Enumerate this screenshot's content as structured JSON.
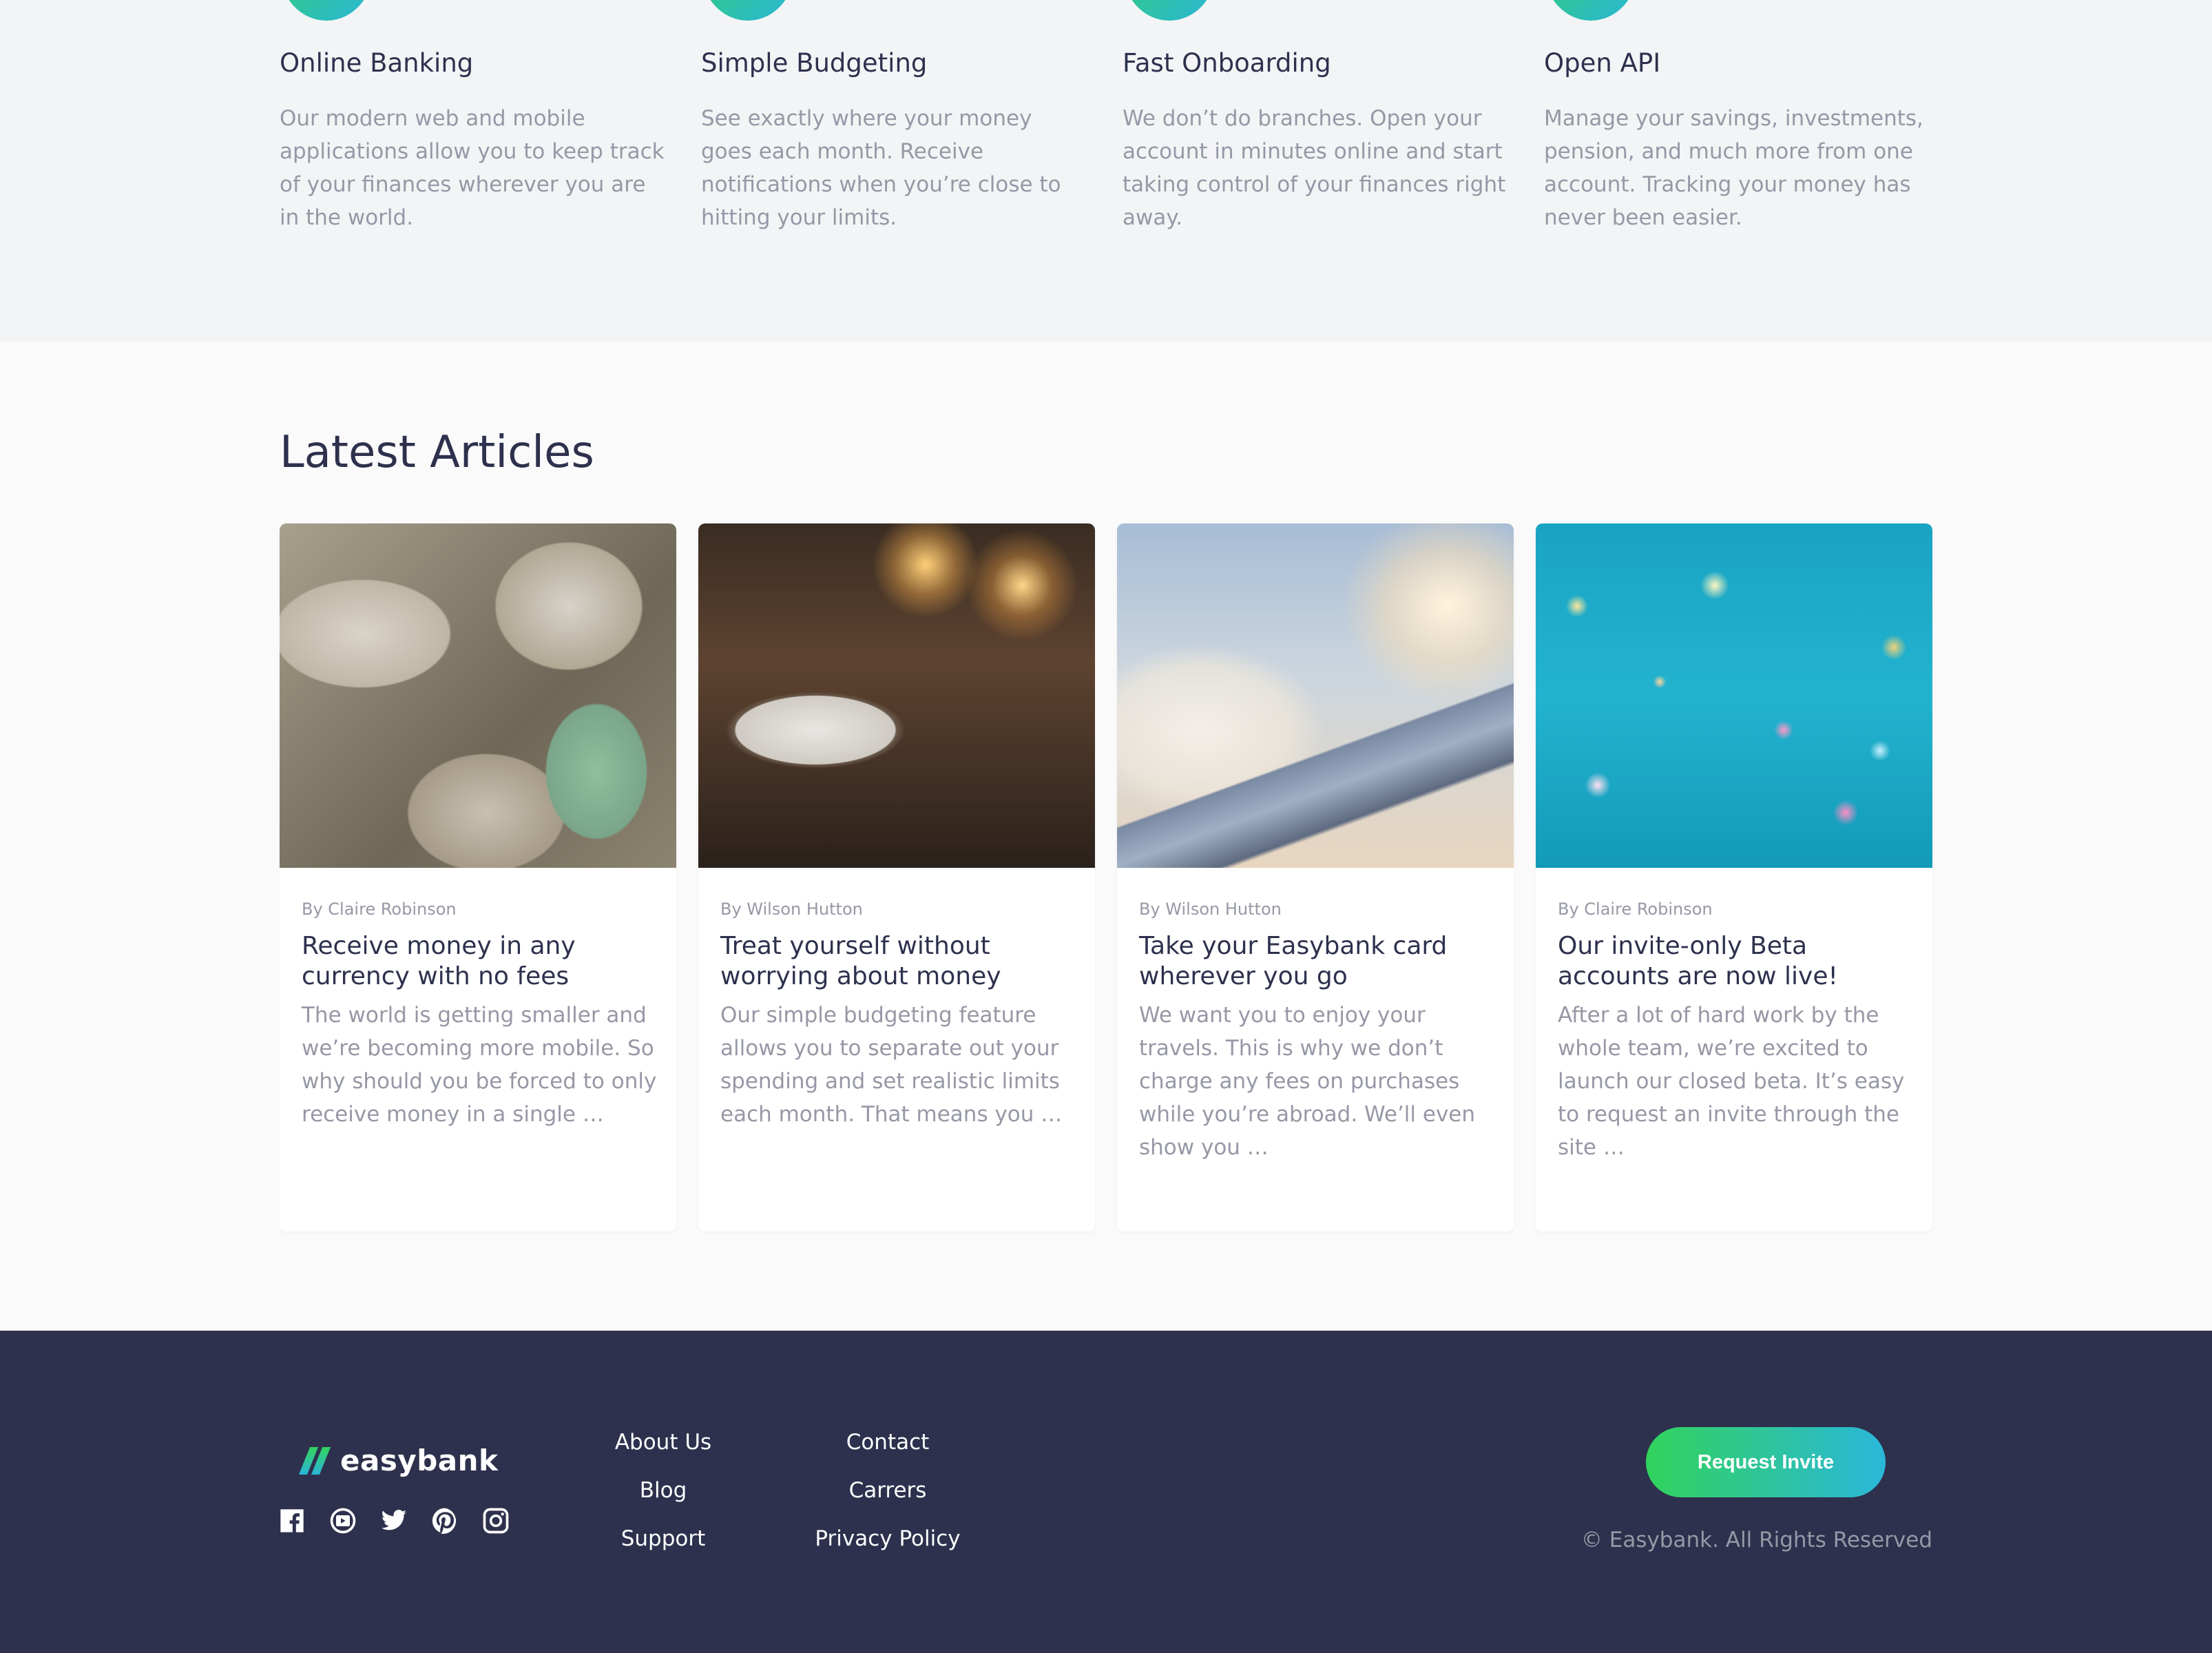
{
  "features": [
    {
      "title": "Online Banking",
      "body": "Our modern web and mobile applications allow you to keep track of your finances wherever you are in the world."
    },
    {
      "title": "Simple Budgeting",
      "body": "See exactly where your money goes each month. Receive notifications when you’re close to hitting your limits."
    },
    {
      "title": "Fast Onboarding",
      "body": "We don’t do branches. Open your account in minutes online and start taking control of your finances right away."
    },
    {
      "title": "Open API",
      "body": "Manage your savings, investments, pension, and much more from one account. Tracking your money has never been easier."
    }
  ],
  "articles": {
    "heading": "Latest Articles",
    "items": [
      {
        "author": "By Claire Robinson",
        "title": "Receive money in any currency with no fees",
        "excerpt": "The world is getting smaller and we’re becoming more mobile. So why should you be forced to only receive money in a single …"
      },
      {
        "author": "By Wilson Hutton",
        "title": "Treat yourself without worrying about money",
        "excerpt": "Our simple budgeting feature allows you to separate out your spending and set realistic limits each month. That means you …"
      },
      {
        "author": "By Wilson Hutton",
        "title": "Take your Easybank card wherever you go",
        "excerpt": "We want you to enjoy your travels. This is why we don’t charge any fees on purchases while you’re abroad. We’ll even show you …"
      },
      {
        "author": "By Claire Robinson",
        "title": "Our invite-only Beta accounts are now live!",
        "excerpt": "After a lot of hard work by the whole team, we’re excited to launch our closed beta. It’s easy to request an invite through the site …"
      }
    ]
  },
  "footer": {
    "brand": "easybank",
    "socials": [
      "facebook-icon",
      "youtube-icon",
      "twitter-icon",
      "pinterest-icon",
      "instagram-icon"
    ],
    "links_col1": [
      "About Us",
      "Blog",
      "Support"
    ],
    "links_col2": [
      "Contact",
      "Carrers",
      "Privacy Policy"
    ],
    "cta": "Request Invite",
    "copyright": "© Easybank. All Rights Reserved"
  },
  "colors": {
    "dark_blue": "#2d314d",
    "lime_green": "#31d35c",
    "bright_cyan": "#2bb7da",
    "grayish_blue": "#9698a6",
    "light_gray": "#f3f4f6"
  }
}
